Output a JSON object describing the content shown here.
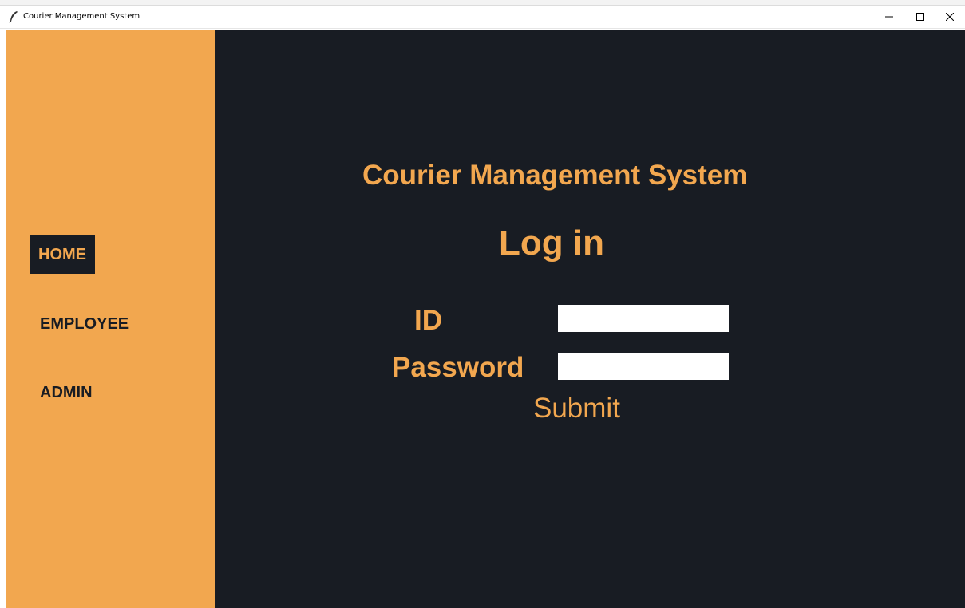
{
  "window": {
    "title": "Courier Management System",
    "app_icon": "feather-icon",
    "controls": {
      "minimize": "minimize-icon",
      "maximize": "maximize-icon",
      "close": "close-icon"
    }
  },
  "sidebar": {
    "items": [
      {
        "label": "HOME",
        "active": true
      },
      {
        "label": "EMPLOYEE",
        "active": false
      },
      {
        "label": "ADMIN",
        "active": false
      }
    ]
  },
  "main": {
    "title": "Courier Management System",
    "subtitle": "Log in",
    "form": {
      "id_label": "ID",
      "id_value": "",
      "password_label": "Password",
      "password_value": "",
      "submit_label": "Submit"
    }
  },
  "colors": {
    "accent": "#f2a74f",
    "background": "#181c23",
    "input_bg": "#ffffff"
  }
}
